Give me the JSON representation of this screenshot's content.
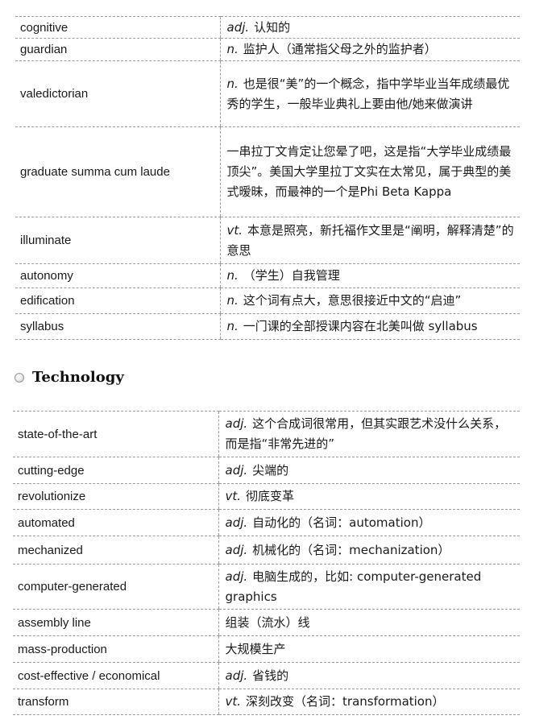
{
  "table1": {
    "rows": [
      {
        "term": "cognitive",
        "pos": "adj.",
        "def": "认知的"
      },
      {
        "term": "guardian",
        "pos": "n.",
        "def": "监护人（通常指父母之外的监护者）"
      },
      {
        "term": "valedictorian",
        "pos": "n.",
        "def": "也是很“美”的一个概念，指中学毕业当年成绩最优秀的学生，一般毕业典礼上要由他/她来做演讲"
      },
      {
        "term": "graduate summa cum laude",
        "pos": "",
        "def": "一串拉丁文肯定让您晕了吧，这是指“大学毕业成绩最顶尖”。美国大学里拉丁文实在太常见，属于典型的美式暧昧，而最神的一个是Phi Beta Kappa"
      },
      {
        "term": "illuminate",
        "pos": "vt.",
        "def": "本意是照亮，新托福作文里是“阐明，解释清楚”的意思"
      },
      {
        "term": "autonomy",
        "pos": "n.",
        "def": "（学生）自我管理"
      },
      {
        "term": "edification",
        "pos": "n.",
        "def": "这个词有点大，意思很接近中文的“启迪”"
      },
      {
        "term": "syllabus",
        "pos": "n.",
        "def": "一门课的全部授课内容在北美叫做 syllabus"
      }
    ]
  },
  "section": {
    "title": "Technology"
  },
  "table2": {
    "rows": [
      {
        "term": "state-of-the-art",
        "pos": "adj.",
        "def": "这个合成词很常用，但其实跟艺术没什么关系，而是指“非常先进的”"
      },
      {
        "term": "cutting-edge",
        "pos": "adj.",
        "def": "尖端的"
      },
      {
        "term": "revolutionize",
        "pos": "vt.",
        "def": "彻底变革"
      },
      {
        "term": "automated",
        "pos": "adj.",
        "def": "自动化的（名词：automation）"
      },
      {
        "term": "mechanized",
        "pos": "adj.",
        "def": "机械化的（名词：mechanization）"
      },
      {
        "term": "computer-generated",
        "pos": "adj.",
        "def": "电脑生成的，比如: computer-generated graphics"
      },
      {
        "term": "assembly line",
        "pos": "",
        "def": "组装（流水）线"
      },
      {
        "term": "mass-production",
        "pos": "",
        "def": "大规模生产"
      },
      {
        "term": "cost-effective / economical",
        "pos": "adj.",
        "def": "省钱的"
      },
      {
        "term": "transform",
        "pos": "vt.",
        "def": "深刻改变（名词：transformation）"
      }
    ]
  }
}
